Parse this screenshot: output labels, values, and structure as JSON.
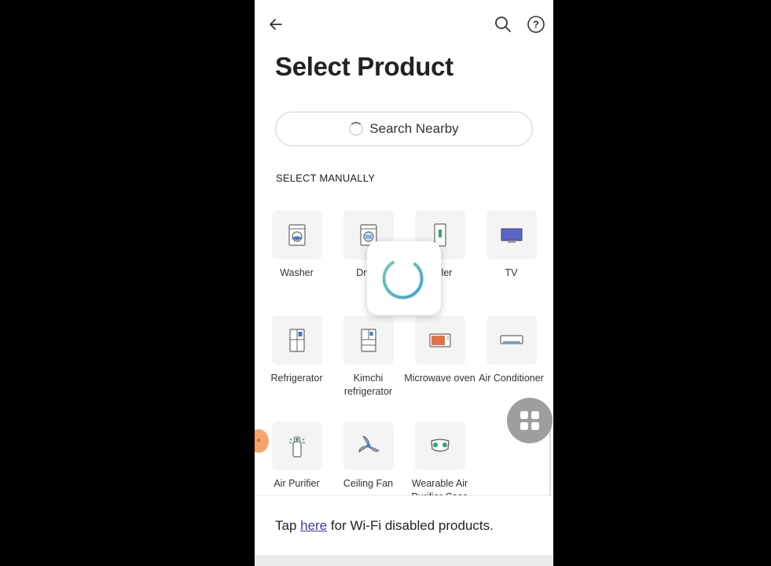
{
  "header": {
    "back_icon": "arrow-left-icon",
    "search_icon": "search-icon",
    "help_icon": "help-icon",
    "help_glyph": "?"
  },
  "page": {
    "title": "Select Product"
  },
  "search_nearby": {
    "label": "Search Nearby"
  },
  "manual": {
    "section_label": "SELECT MANUALLY",
    "products": [
      {
        "label": "Washer",
        "icon": "washer-icon"
      },
      {
        "label": "Dryer",
        "icon": "dryer-icon"
      },
      {
        "label": "Styler",
        "icon": "styler-icon"
      },
      {
        "label": "TV",
        "icon": "tv-icon"
      },
      {
        "label": "Refrigerator",
        "icon": "refrigerator-icon"
      },
      {
        "label": "Kimchi refrigerator",
        "icon": "kimchi-refrigerator-icon"
      },
      {
        "label": "Microwave oven",
        "icon": "microwave-icon"
      },
      {
        "label": "Air Conditioner",
        "icon": "air-conditioner-icon"
      },
      {
        "label": "Air Purifier",
        "icon": "air-purifier-icon"
      },
      {
        "label": "Ceiling Fan",
        "icon": "ceiling-fan-icon"
      },
      {
        "label": "Wearable Air Purifier Case",
        "icon": "wearable-air-purifier-icon"
      }
    ]
  },
  "footer": {
    "prefix": "Tap ",
    "link": "here",
    "suffix": " for Wi-Fi disabled products."
  },
  "colors": {
    "accent": "#3b3b9c",
    "spinner_blue": "#3aa6d8",
    "spinner_green": "#78c8b0",
    "floating_button": "#9e9e9e"
  }
}
